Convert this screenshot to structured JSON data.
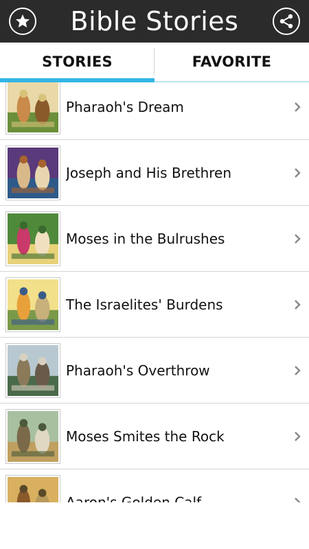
{
  "app_bar": {
    "title": "Bible Stories",
    "left_icon": "star-icon",
    "right_icon": "share-icon",
    "background": "#2b2b2b"
  },
  "tabs": [
    {
      "label": "STORIES",
      "active": true
    },
    {
      "label": "FAVORITE",
      "active": false
    }
  ],
  "accent_color": "#33b5e5",
  "stories": [
    {
      "title": "Pharaoh's Dream",
      "thumbnail": "illustration-pharaohs-dream"
    },
    {
      "title": "Joseph and His Brethren",
      "thumbnail": "illustration-joseph-brethren"
    },
    {
      "title": "Moses in the Bulrushes",
      "thumbnail": "illustration-moses-bulrushes"
    },
    {
      "title": "The Israelites' Burdens",
      "thumbnail": "illustration-israelites-burdens"
    },
    {
      "title": "Pharaoh's Overthrow",
      "thumbnail": "illustration-pharaohs-overthrow"
    },
    {
      "title": "Moses Smites the Rock",
      "thumbnail": "illustration-moses-smites-rock"
    },
    {
      "title": "Aaron's Golden Calf",
      "thumbnail": "illustration-golden-calf"
    }
  ]
}
